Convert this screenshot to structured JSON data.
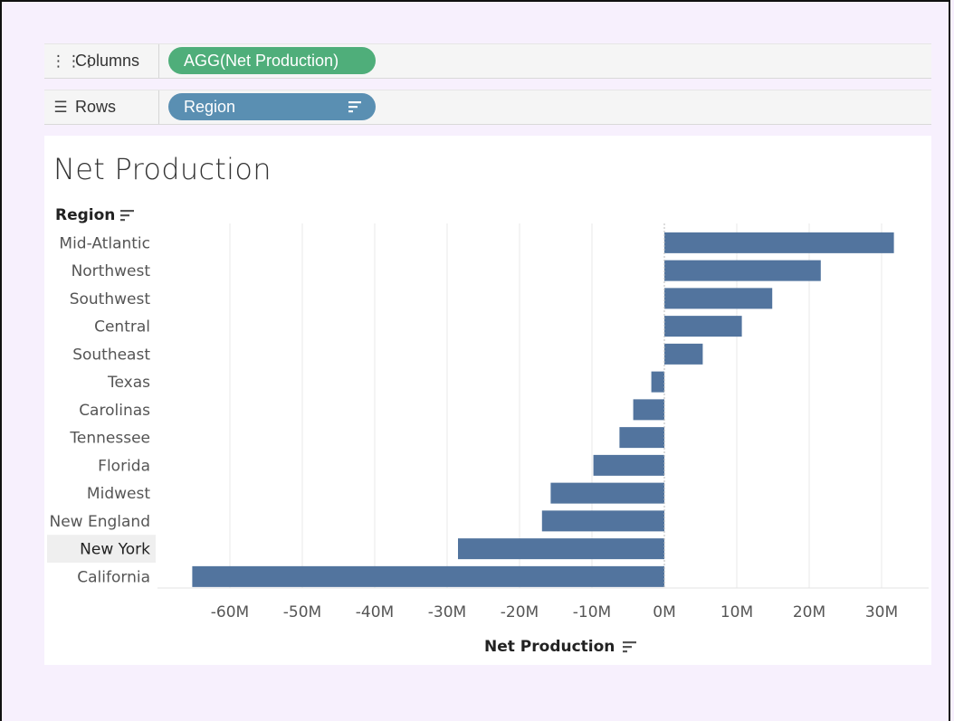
{
  "shelves": {
    "columns": {
      "label": "Columns",
      "pill": "AGG(Net Production)"
    },
    "rows": {
      "label": "Rows",
      "pill": "Region"
    }
  },
  "chart_data": {
    "type": "bar",
    "orientation": "horizontal",
    "title": "Net Production",
    "ylabel": "Region",
    "xlabel": "Net Production",
    "categories": [
      "Mid-Atlantic",
      "Northwest",
      "Southwest",
      "Central",
      "Southeast",
      "Texas",
      "Carolinas",
      "Tennessee",
      "Florida",
      "Midwest",
      "New England",
      "New York",
      "California"
    ],
    "values": [
      31700000,
      21600000,
      14900000,
      10700000,
      5300000,
      -1800000,
      -4300000,
      -6200000,
      -9800000,
      -15700000,
      -16900000,
      -28500000,
      -65200000
    ],
    "xticks": [
      "-60M",
      "-50M",
      "-40M",
      "-30M",
      "-20M",
      "-10M",
      "0M",
      "10M",
      "20M",
      "30M"
    ],
    "xlim": [
      -70000000,
      36000000
    ],
    "highlighted_category": "New York",
    "grid": true,
    "colors": {
      "bar": "#52749e",
      "grid": "#e8e8e8",
      "highlight_row": "#efefef"
    }
  }
}
